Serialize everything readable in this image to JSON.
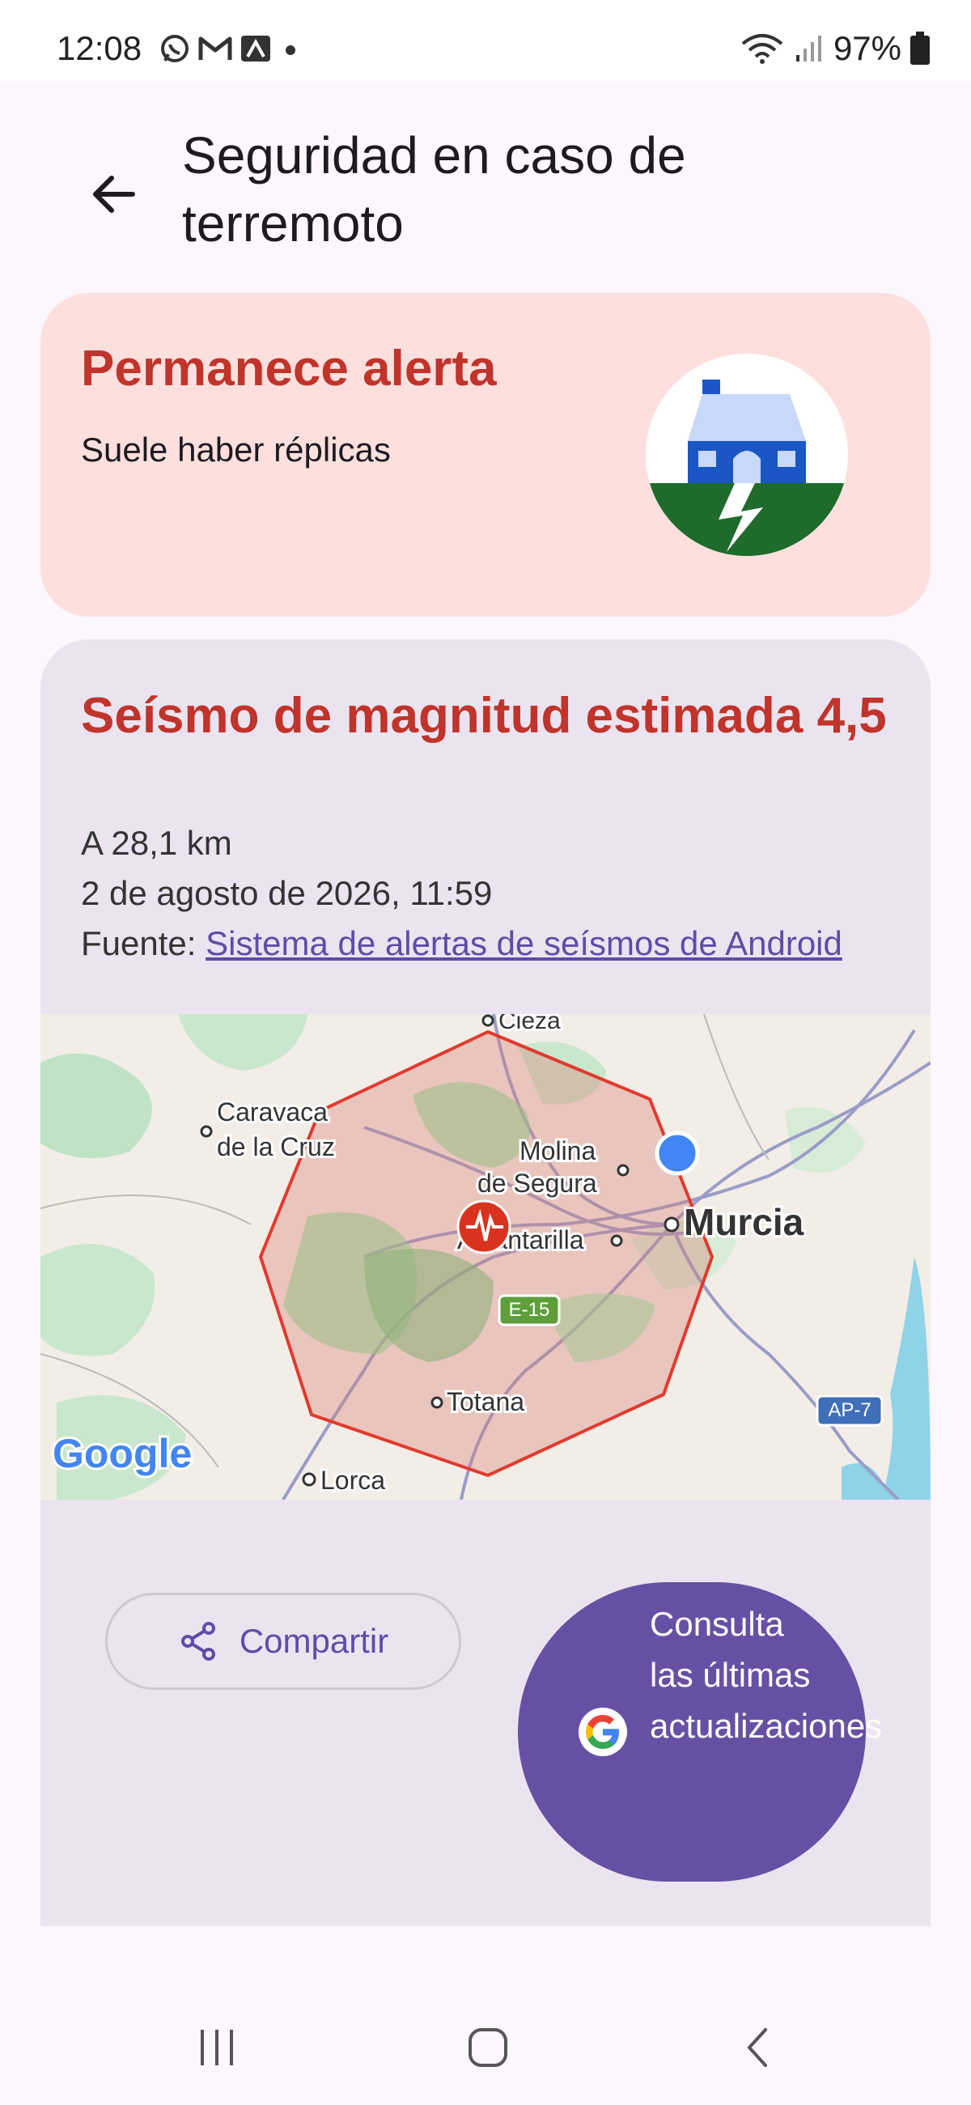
{
  "status_bar": {
    "time": "12:08",
    "battery": "97%",
    "left_icons": [
      "whatsapp-icon",
      "gmail-icon",
      "app-icon",
      "dot-icon"
    ],
    "right_icons": [
      "wifi-icon",
      "signal-icon",
      "battery-icon"
    ]
  },
  "header": {
    "title": "Seguridad en caso de terremoto",
    "back_icon": "back-arrow-icon"
  },
  "alert_card": {
    "title": "Permanece alerta",
    "subtitle": "Suele haber réplicas",
    "illustration": "house-crack-illustration"
  },
  "quake_card": {
    "title": "Seísmo de magnitud estimada 4,5",
    "distance": "A 28,1 km",
    "date": "2 de agosto de 2026, 11:59",
    "source_label": "Fuente:",
    "source_link": "Sistema de alertas de seísmos de Android"
  },
  "map": {
    "places": {
      "cieza": "Cieza",
      "caravaca1": "Caravaca",
      "caravaca2": "de la Cruz",
      "molina1": "Molina",
      "molina2": "de Segura",
      "alcantarilla": "Alcantarilla",
      "murcia": "Murcia",
      "totana": "Totana",
      "lorca": "Lorca"
    },
    "roads": {
      "e15": "E-15",
      "ap7": "AP-7"
    },
    "logo": "Google"
  },
  "actions": {
    "share_label": "Compartir",
    "updates_label": "Consulta las últimas actualizaciones"
  },
  "colors": {
    "accent": "#6750a4",
    "alert_red": "#c0342b",
    "alert_bg": "#fde0de",
    "card_bg": "#ebe4f0"
  },
  "nav": {
    "items": [
      "recents-icon",
      "home-icon",
      "back-icon"
    ]
  }
}
